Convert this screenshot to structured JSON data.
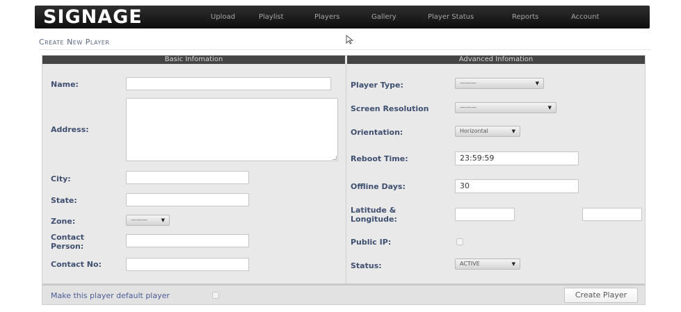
{
  "app": {
    "logo": "SIGNAGE"
  },
  "nav": [
    {
      "label": "Upload"
    },
    {
      "label": "Playlist"
    },
    {
      "label": "Players"
    },
    {
      "label": "Gallery"
    },
    {
      "label": "Player Status"
    },
    {
      "label": "Reports"
    },
    {
      "label": "Account"
    }
  ],
  "page": {
    "title": "Create New Player"
  },
  "basic": {
    "header": "Basic Infomation",
    "name_label": "Name:",
    "name_value": "",
    "address_label": "Address:",
    "address_value": "",
    "city_label": "City:",
    "city_value": "",
    "state_label": "State:",
    "state_value": "",
    "zone_label": "Zone:",
    "zone_value": "———",
    "contact_person_label": "Contact Person:",
    "contact_person_value": "",
    "contact_no_label": "Contact No:",
    "contact_no_value": ""
  },
  "advanced": {
    "header": "Advanced Infomation",
    "player_type_label": "Player Type:",
    "player_type_value": "———",
    "screen_resolution_label": "Screen Resolution",
    "screen_resolution_value": "———",
    "orientation_label": "Orientation:",
    "orientation_value": "Horizontal",
    "reboot_time_label": "Reboot Time:",
    "reboot_time_value": "23:59:59",
    "offline_days_label": "Offline Days:",
    "offline_days_value": "30",
    "latlng_label": "Latitude & Longitude:",
    "latitude_value": "",
    "longitude_value": "",
    "public_ip_label": "Public IP:",
    "public_ip_checked": false,
    "status_label": "Status:",
    "status_value": "ACTIVE"
  },
  "footer": {
    "default_player_label": "Make this player default player",
    "default_player_checked": false,
    "create_button": "Create Player"
  },
  "icons": {
    "cursor": "mouse-pointer-icon",
    "dropdown": "dropdown-arrow-icon"
  },
  "colors": {
    "topbar": "#1a1a1a",
    "panel": "#e9e9e9",
    "header": "#444444",
    "label": "#3f4f70",
    "link": "#4a5c96"
  }
}
